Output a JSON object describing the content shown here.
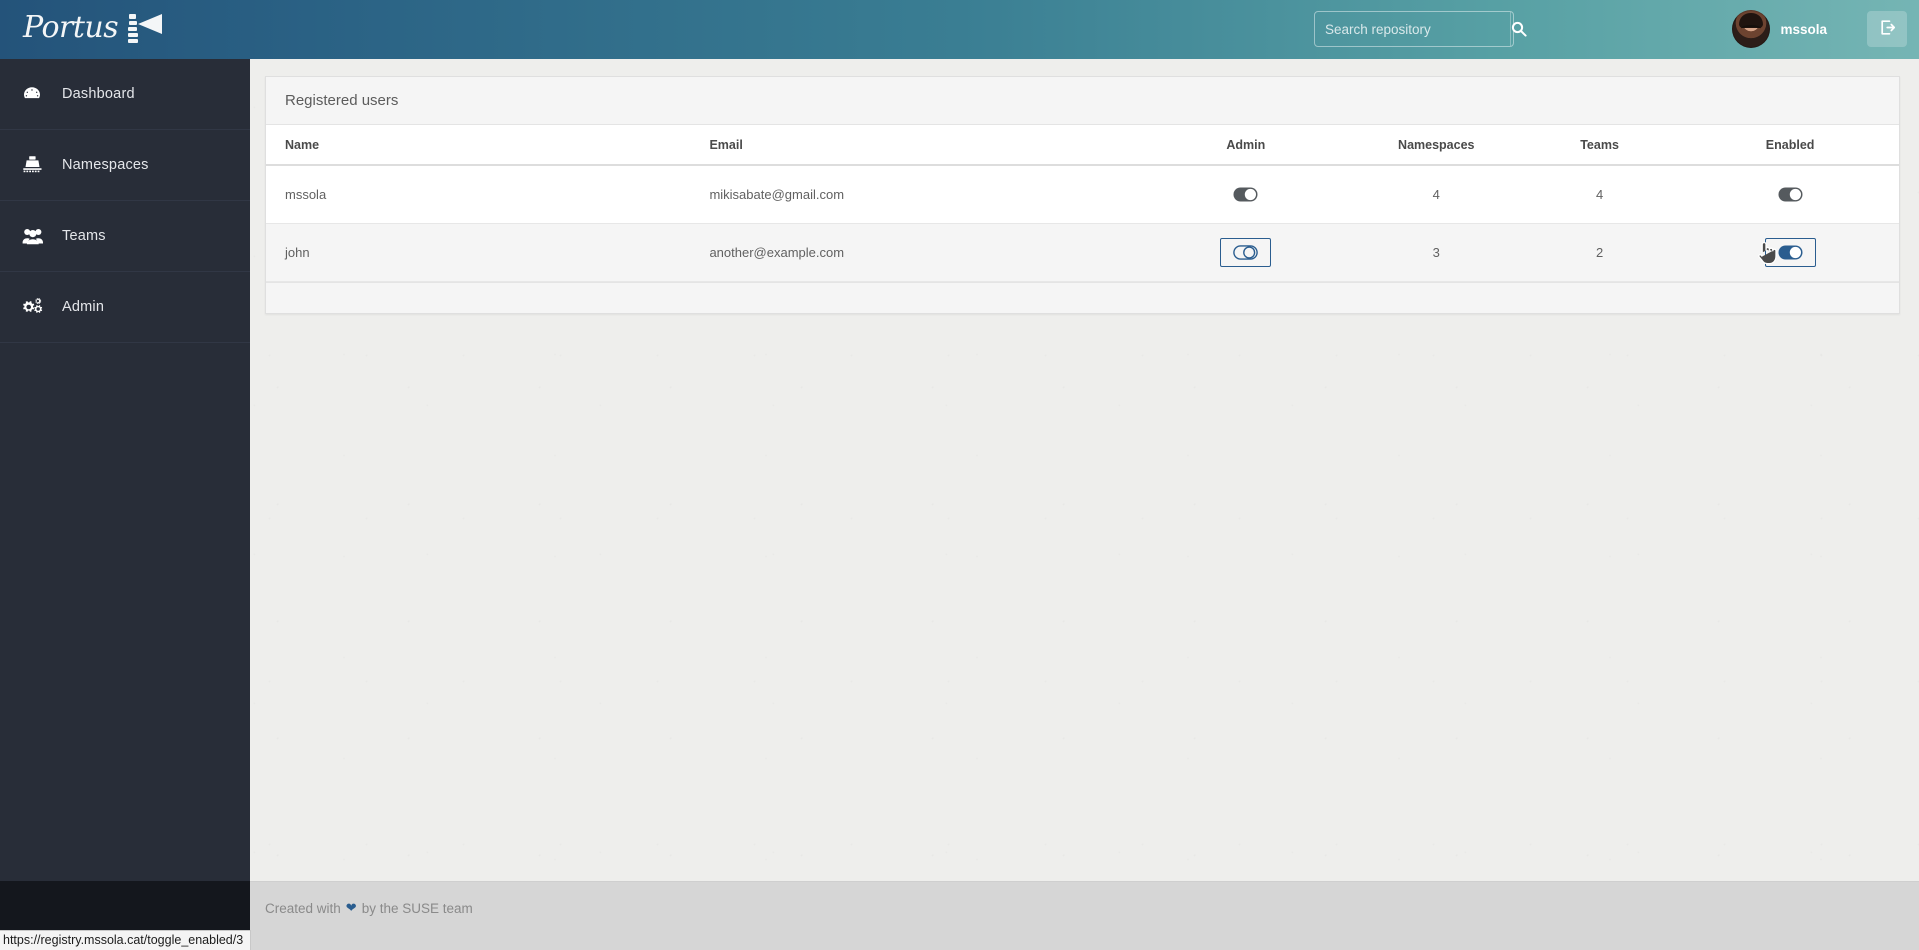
{
  "header": {
    "logo_text": "Portus",
    "logo_icon": "lighthouse-icon",
    "search": {
      "placeholder": "Search repository",
      "value": "",
      "icon": "search-icon"
    },
    "username": "mssola",
    "avatar_alt": "user-avatar",
    "logout_icon": "sign-out-icon",
    "gradient_left": "#24537a",
    "gradient_right": "#75b5b4"
  },
  "sidebar": {
    "items": [
      {
        "label": "Dashboard",
        "icon": "dashboard-icon"
      },
      {
        "label": "Namespaces",
        "icon": "ship-icon"
      },
      {
        "label": "Teams",
        "icon": "users-icon"
      },
      {
        "label": "Admin",
        "icon": "cogs-icon"
      }
    ]
  },
  "main": {
    "panel_title": "Registered users",
    "table": {
      "columns": [
        "Name",
        "Email",
        "Admin",
        "Namespaces",
        "Teams",
        "Enabled"
      ],
      "rows": [
        {
          "name": "mssola",
          "email": "mikisabate@gmail.com",
          "admin": "toggle-on",
          "admin_state": "on",
          "namespaces": "4",
          "teams": "4",
          "enabled": "toggle-on",
          "enabled_state": "on"
        },
        {
          "name": "john",
          "email": "another@example.com",
          "admin": "toggle-outline",
          "admin_state": "off-focused",
          "namespaces": "3",
          "teams": "2",
          "enabled": "toggle-on",
          "enabled_state": "on-focused"
        }
      ]
    }
  },
  "footer": {
    "prefix": "Created with",
    "heart_icon": "heart-icon",
    "suffix": "by the SUSE team",
    "heart_color": "#2a5d8f"
  },
  "statusbar": {
    "url": "https://registry.mssola.cat/toggle_enabled/3"
  }
}
